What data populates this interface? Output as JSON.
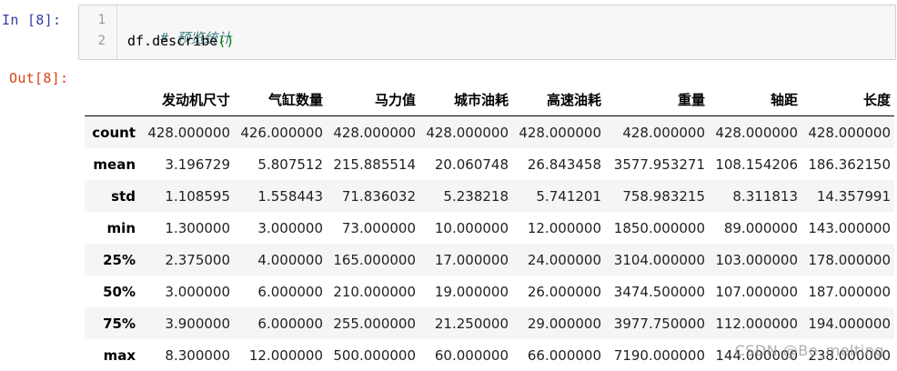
{
  "input_prompt": "In  [8]:",
  "output_prompt": "Out[8]:",
  "code": {
    "line_numbers": [
      "1",
      "2"
    ],
    "comment": "# 预览统计",
    "call_prefix": "df.describe",
    "call_parens": "()"
  },
  "table": {
    "columns": [
      "发动机尺寸",
      "气缸数量",
      "马力值",
      "城市油耗",
      "高速油耗",
      "重量",
      "轴距",
      "长度"
    ],
    "rows": [
      {
        "label": "count",
        "values": [
          "428.000000",
          "426.000000",
          "428.000000",
          "428.000000",
          "428.000000",
          "428.000000",
          "428.000000",
          "428.000000"
        ]
      },
      {
        "label": "mean",
        "values": [
          "3.196729",
          "5.807512",
          "215.885514",
          "20.060748",
          "26.843458",
          "3577.953271",
          "108.154206",
          "186.362150"
        ]
      },
      {
        "label": "std",
        "values": [
          "1.108595",
          "1.558443",
          "71.836032",
          "5.238218",
          "5.741201",
          "758.983215",
          "8.311813",
          "14.357991"
        ]
      },
      {
        "label": "min",
        "values": [
          "1.300000",
          "3.000000",
          "73.000000",
          "10.000000",
          "12.000000",
          "1850.000000",
          "89.000000",
          "143.000000"
        ]
      },
      {
        "label": "25%",
        "values": [
          "2.375000",
          "4.000000",
          "165.000000",
          "17.000000",
          "24.000000",
          "3104.000000",
          "103.000000",
          "178.000000"
        ]
      },
      {
        "label": "50%",
        "values": [
          "3.000000",
          "6.000000",
          "210.000000",
          "19.000000",
          "26.000000",
          "3474.500000",
          "107.000000",
          "187.000000"
        ]
      },
      {
        "label": "75%",
        "values": [
          "3.900000",
          "6.000000",
          "255.000000",
          "21.250000",
          "29.000000",
          "3977.750000",
          "112.000000",
          "194.000000"
        ]
      },
      {
        "label": "max",
        "values": [
          "8.300000",
          "12.000000",
          "500.000000",
          "60.000000",
          "66.000000",
          "7190.000000",
          "144.000000",
          "238.000000"
        ]
      }
    ]
  },
  "watermark": "CSDN @Be_melting",
  "colors": {
    "input_prompt": "#303f9f",
    "output_prompt": "#d84315",
    "comment": "#408080",
    "paren": "#008000"
  }
}
